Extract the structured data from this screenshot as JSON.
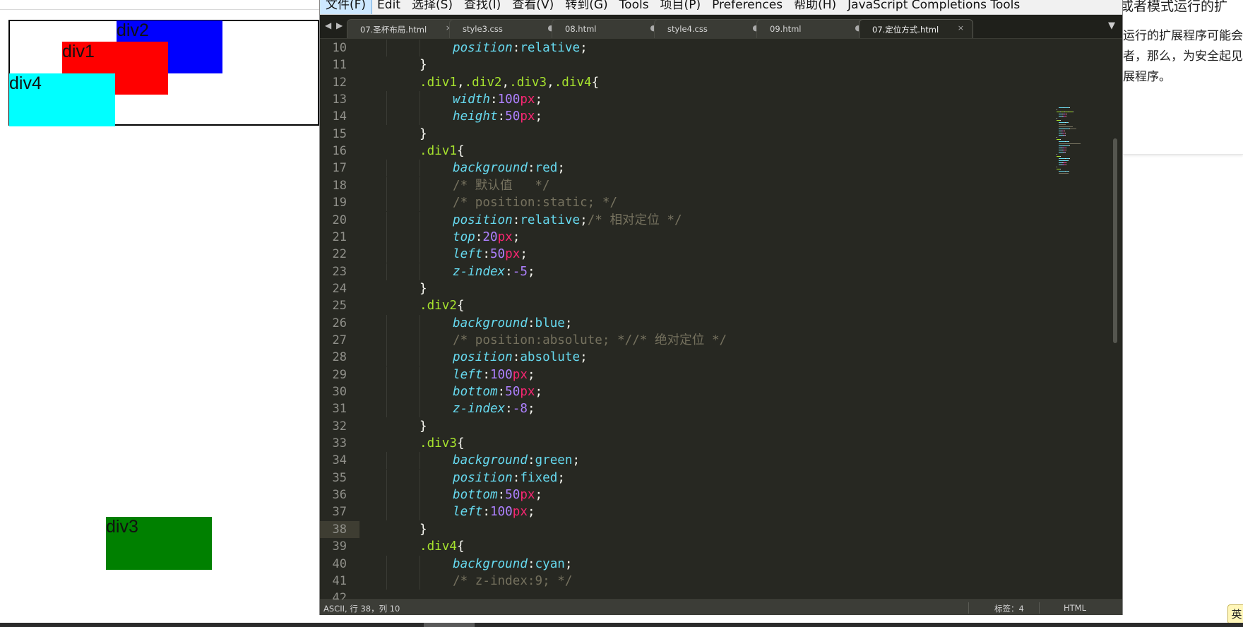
{
  "preview": {
    "boxes": {
      "div1": {
        "label": "div1",
        "color": "#ff0000"
      },
      "div2": {
        "label": "div2",
        "color": "#0000ff"
      },
      "div3": {
        "label": "div3",
        "color": "#008000"
      },
      "div4": {
        "label": "div4",
        "color": "#00ffff"
      }
    }
  },
  "background_page": {
    "heading": "或者模式运行的扩",
    "lines": [
      "运行的扩展程序可能会损",
      "者，那么，为安全起见",
      "展程序。"
    ]
  },
  "ime_indicator": "英",
  "editor": {
    "menu": [
      "文件(F)",
      "Edit",
      "选择(S)",
      "查找(I)",
      "查看(V)",
      "转到(G)",
      "Tools",
      "项目(P)",
      "Preferences",
      "帮助(H)",
      "JavaScript Completions Tools"
    ],
    "active_menu_index": 0,
    "tabs": [
      {
        "label": "07.圣杯布局.html",
        "button": "×",
        "active": false
      },
      {
        "label": "style3.css",
        "button": "●",
        "active": false
      },
      {
        "label": "08.html",
        "button": "●",
        "active": false
      },
      {
        "label": "style4.css",
        "button": "●",
        "active": false
      },
      {
        "label": "09.html",
        "button": "●",
        "active": false
      },
      {
        "label": "07.定位方式.html",
        "button": "×",
        "active": true
      }
    ],
    "tab_nav_prev": "◀",
    "tab_nav_next": "▶",
    "tab_overflow": "▼",
    "current_line": 38,
    "code": [
      {
        "n": "10",
        "indent": 2,
        "tokens": [
          [
            "prop",
            "position"
          ],
          [
            "punc",
            ":"
          ],
          [
            "val",
            "relative"
          ],
          [
            "punc",
            ";"
          ]
        ]
      },
      {
        "n": "11",
        "indent": 1,
        "tokens": [
          [
            "punc",
            "}"
          ]
        ]
      },
      {
        "n": "12",
        "indent": 1,
        "tokens": [
          [
            "sel",
            ".div1"
          ],
          [
            "punc",
            ","
          ],
          [
            "sel",
            ".div2"
          ],
          [
            "punc",
            ","
          ],
          [
            "sel",
            ".div3"
          ],
          [
            "punc",
            ","
          ],
          [
            "sel",
            ".div4"
          ],
          [
            "punc",
            "{"
          ]
        ]
      },
      {
        "n": "13",
        "indent": 2,
        "tokens": [
          [
            "prop",
            "width"
          ],
          [
            "punc",
            ":"
          ],
          [
            "num",
            "100"
          ],
          [
            "unit",
            "px"
          ],
          [
            "punc",
            ";"
          ]
        ]
      },
      {
        "n": "14",
        "indent": 2,
        "tokens": [
          [
            "prop",
            "height"
          ],
          [
            "punc",
            ":"
          ],
          [
            "num",
            "50"
          ],
          [
            "unit",
            "px"
          ],
          [
            "punc",
            ";"
          ]
        ]
      },
      {
        "n": "15",
        "indent": 1,
        "tokens": [
          [
            "punc",
            "}"
          ]
        ]
      },
      {
        "n": "16",
        "indent": 1,
        "tokens": [
          [
            "sel",
            ".div1"
          ],
          [
            "punc",
            "{"
          ]
        ]
      },
      {
        "n": "17",
        "indent": 2,
        "tokens": [
          [
            "prop",
            "background"
          ],
          [
            "punc",
            ":"
          ],
          [
            "val",
            "red"
          ],
          [
            "punc",
            ";"
          ]
        ]
      },
      {
        "n": "18",
        "indent": 2,
        "tokens": [
          [
            "com",
            "/* 默认值   */"
          ]
        ]
      },
      {
        "n": "19",
        "indent": 2,
        "tokens": [
          [
            "com",
            "/* position:static; */"
          ]
        ]
      },
      {
        "n": "20",
        "indent": 2,
        "tokens": [
          [
            "prop",
            "position"
          ],
          [
            "punc",
            ":"
          ],
          [
            "val",
            "relative"
          ],
          [
            "punc",
            ";"
          ],
          [
            "com",
            "/* 相对定位 */"
          ]
        ]
      },
      {
        "n": "21",
        "indent": 2,
        "tokens": [
          [
            "prop",
            "top"
          ],
          [
            "punc",
            ":"
          ],
          [
            "num",
            "20"
          ],
          [
            "unit",
            "px"
          ],
          [
            "punc",
            ";"
          ]
        ]
      },
      {
        "n": "22",
        "indent": 2,
        "tokens": [
          [
            "prop",
            "left"
          ],
          [
            "punc",
            ":"
          ],
          [
            "num",
            "50"
          ],
          [
            "unit",
            "px"
          ],
          [
            "punc",
            ";"
          ]
        ]
      },
      {
        "n": "23",
        "indent": 2,
        "tokens": [
          [
            "prop",
            "z-index"
          ],
          [
            "punc",
            ":"
          ],
          [
            "num",
            "-5"
          ],
          [
            "punc",
            ";"
          ]
        ]
      },
      {
        "n": "24",
        "indent": 1,
        "tokens": [
          [
            "punc",
            "}"
          ]
        ]
      },
      {
        "n": "25",
        "indent": 1,
        "tokens": [
          [
            "sel",
            ".div2"
          ],
          [
            "punc",
            "{"
          ]
        ]
      },
      {
        "n": "26",
        "indent": 2,
        "tokens": [
          [
            "prop",
            "background"
          ],
          [
            "punc",
            ":"
          ],
          [
            "val",
            "blue"
          ],
          [
            "punc",
            ";"
          ]
        ]
      },
      {
        "n": "27",
        "indent": 2,
        "tokens": [
          [
            "com",
            "/* position:absolute; *//* 绝对定位 */"
          ]
        ]
      },
      {
        "n": "28",
        "indent": 2,
        "tokens": [
          [
            "prop",
            "position"
          ],
          [
            "punc",
            ":"
          ],
          [
            "val",
            "absolute"
          ],
          [
            "punc",
            ";"
          ]
        ]
      },
      {
        "n": "29",
        "indent": 2,
        "tokens": [
          [
            "prop",
            "left"
          ],
          [
            "punc",
            ":"
          ],
          [
            "num",
            "100"
          ],
          [
            "unit",
            "px"
          ],
          [
            "punc",
            ";"
          ]
        ]
      },
      {
        "n": "30",
        "indent": 2,
        "tokens": [
          [
            "prop",
            "bottom"
          ],
          [
            "punc",
            ":"
          ],
          [
            "num",
            "50"
          ],
          [
            "unit",
            "px"
          ],
          [
            "punc",
            ";"
          ]
        ]
      },
      {
        "n": "31",
        "indent": 2,
        "tokens": [
          [
            "prop",
            "z-index"
          ],
          [
            "punc",
            ":"
          ],
          [
            "num",
            "-8"
          ],
          [
            "punc",
            ";"
          ]
        ]
      },
      {
        "n": "32",
        "indent": 1,
        "tokens": [
          [
            "punc",
            "}"
          ]
        ]
      },
      {
        "n": "33",
        "indent": 1,
        "tokens": [
          [
            "sel",
            ".div3"
          ],
          [
            "punc",
            "{"
          ]
        ]
      },
      {
        "n": "34",
        "indent": 2,
        "tokens": [
          [
            "prop",
            "background"
          ],
          [
            "punc",
            ":"
          ],
          [
            "val",
            "green"
          ],
          [
            "punc",
            ";"
          ]
        ]
      },
      {
        "n": "35",
        "indent": 2,
        "tokens": [
          [
            "prop",
            "position"
          ],
          [
            "punc",
            ":"
          ],
          [
            "val",
            "fixed"
          ],
          [
            "punc",
            ";"
          ]
        ]
      },
      {
        "n": "36",
        "indent": 2,
        "tokens": [
          [
            "prop",
            "bottom"
          ],
          [
            "punc",
            ":"
          ],
          [
            "num",
            "50"
          ],
          [
            "unit",
            "px"
          ],
          [
            "punc",
            ";"
          ]
        ]
      },
      {
        "n": "37",
        "indent": 2,
        "tokens": [
          [
            "prop",
            "left"
          ],
          [
            "punc",
            ":"
          ],
          [
            "num",
            "100"
          ],
          [
            "unit",
            "px"
          ],
          [
            "punc",
            ";"
          ]
        ]
      },
      {
        "n": "38",
        "indent": 1,
        "tokens": [
          [
            "punc",
            "}"
          ]
        ]
      },
      {
        "n": "39",
        "indent": 1,
        "tokens": [
          [
            "sel",
            ".div4"
          ],
          [
            "punc",
            "{"
          ]
        ]
      },
      {
        "n": "40",
        "indent": 2,
        "tokens": [
          [
            "prop",
            "background"
          ],
          [
            "punc",
            ":"
          ],
          [
            "val",
            "cyan"
          ],
          [
            "punc",
            ";"
          ]
        ]
      },
      {
        "n": "41",
        "indent": 2,
        "tokens": [
          [
            "com",
            "/* z-index:9; */"
          ]
        ]
      },
      {
        "n": "42",
        "indent": 0,
        "tokens": []
      }
    ],
    "status": {
      "position": "ASCII, 行 38，列 10",
      "tab_size": "标签：4",
      "syntax": "HTML"
    }
  }
}
